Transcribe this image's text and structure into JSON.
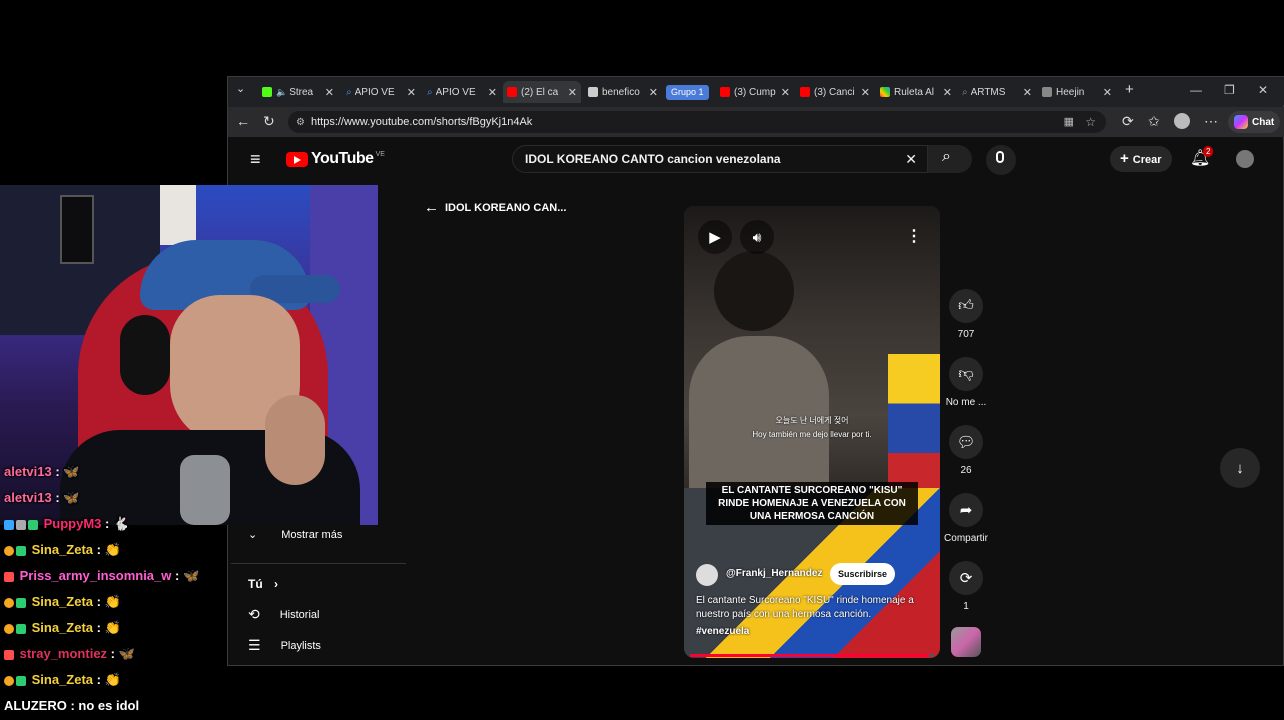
{
  "browser": {
    "tabs": [
      {
        "title": "Strea",
        "color": "#53fc18"
      },
      {
        "title": "APIO VE",
        "color": "#4a8ff0"
      },
      {
        "title": "APIO VE",
        "color": "#4a8ff0"
      },
      {
        "title": "(2) El ca",
        "color": "#ff0000"
      },
      {
        "title": "benefico",
        "color": "#cccccc"
      },
      {
        "title": "(3) Cump",
        "color": "#ff0000"
      },
      {
        "title": "(3) Canci",
        "color": "#ff0000"
      },
      {
        "title": "Ruleta Al",
        "color": "#ff9900"
      },
      {
        "title": "ARTMS",
        "color": "#888888"
      },
      {
        "title": "Heejin",
        "color": "#888888"
      }
    ],
    "group_label": "Grupo 1",
    "url": "https://www.youtube.com/shorts/fBgyKj1n4Ak",
    "chat_label": "Chat"
  },
  "youtube": {
    "logo_text": "YouTube",
    "logo_region": "VE",
    "search_value": "IDOL KOREANO CANTO cancion venezolana",
    "create_label": "Crear",
    "notifications_count": "2",
    "back_title": "IDOL KOREANO CAN...",
    "sidebar": {
      "show_more": "Mostrar más",
      "you": "Tú",
      "history": "Historial",
      "playlists": "Playlists"
    },
    "short": {
      "subtitle_korean": "오늘도 난 너에게 젖어",
      "subtitle_spanish": "Hoy también me dejo llevar por ti.",
      "banner": "EL CANTANTE SURCOREANO \"KISU\" RINDE HOMENAJE A VENEZUELA CON UNA HERMOSA CANCIÓN",
      "channel": "@Frankj_Hernandez",
      "subscribe_label": "Suscribirse",
      "description": "El cantante Surcoreano \"KISU\" rinde homenaje a nuestro país con una hermosa canción.",
      "hashtag": "#venezuela",
      "progress": 0.98
    },
    "actions": {
      "likes": "707",
      "dislike_label": "No me ...",
      "comments": "26",
      "share_label": "Compartir",
      "remix": "1"
    }
  },
  "chat": [
    {
      "user": "aletvi13",
      "color": "#ff6b9a",
      "message": "🦋",
      "badge": ""
    },
    {
      "user": "aletvi13",
      "color": "#ff6b9a",
      "message": "🦋",
      "badge": ""
    },
    {
      "user": "PuppyM3",
      "color": "#ff2a6d",
      "message": "🐇",
      "badge": "#3aa7ff"
    },
    {
      "user": "Sina_Zeta",
      "color": "#f5d23b",
      "message": "👏",
      "badge": "#f5a623"
    },
    {
      "user": "Priss_army_insomnia_w",
      "color": "#ff5fd0",
      "message": "🦋",
      "badge": "#ff4d4d"
    },
    {
      "user": "Sina_Zeta",
      "color": "#f5d23b",
      "message": "👏",
      "badge": "#f5a623"
    },
    {
      "user": "Sina_Zeta",
      "color": "#f5d23b",
      "message": "👏",
      "badge": "#f5a623"
    },
    {
      "user": "stray_montiez",
      "color": "#e0325a",
      "message": "🦋",
      "badge": "#ff4d4d"
    },
    {
      "user": "Sina_Zeta",
      "color": "#f5d23b",
      "message": "👏",
      "badge": "#f5a623"
    },
    {
      "user": "ALUZERO",
      "color": "#ffffff",
      "message": "no es idol",
      "badge": ""
    }
  ]
}
